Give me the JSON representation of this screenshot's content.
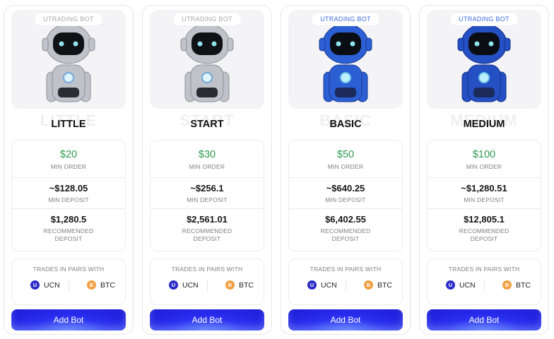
{
  "colors": {
    "accent": "#2a2ff0",
    "price": "#2d9a4e",
    "silver_robot": "#b9bcc2",
    "blue_robot": "#2554c8"
  },
  "plans": [
    {
      "tag": "UTRADING BOT",
      "robot": "silver",
      "ghost": "LITTLE",
      "name": "LITTLE",
      "price": "$20",
      "price_label": "MIN ORDER",
      "min_deposit": "~$128.05",
      "min_deposit_label": "MIN DEPOSIT",
      "recommended": "$1,280.5",
      "recommended_label_1": "RECOMMENDED",
      "recommended_label_2": "DEPOSIT",
      "pairs_label": "TRADES IN PAIRS WITH",
      "coin_a": "UCN",
      "coin_b": "BTC",
      "button": "Add Bot"
    },
    {
      "tag": "UTRADING BOT",
      "robot": "silver",
      "ghost": "START",
      "name": "START",
      "price": "$30",
      "price_label": "MIN ORDER",
      "min_deposit": "~$256.1",
      "min_deposit_label": "MIN DEPOSIT",
      "recommended": "$2,561.01",
      "recommended_label_1": "RECOMMENDED",
      "recommended_label_2": "DEPOSIT",
      "pairs_label": "TRADES IN PAIRS WITH",
      "coin_a": "UCN",
      "coin_b": "BTC",
      "button": "Add Bot"
    },
    {
      "tag": "UTRADING BOT",
      "robot": "blue",
      "ghost": "BASIC",
      "name": "BASIC",
      "price": "$50",
      "price_label": "MIN ORDER",
      "min_deposit": "~$640.25",
      "min_deposit_label": "MIN DEPOSIT",
      "recommended": "$6,402.55",
      "recommended_label_1": "RECOMMENDED",
      "recommended_label_2": "DEPOSIT",
      "pairs_label": "TRADES IN PAIRS WITH",
      "coin_a": "UCN",
      "coin_b": "BTC",
      "button": "Add Bot"
    },
    {
      "tag": "UTRADING BOT",
      "robot": "blue",
      "ghost": "MEDIUM",
      "name": "MEDIUM",
      "price": "$100",
      "price_label": "MIN ORDER",
      "min_deposit": "~$1,280.51",
      "min_deposit_label": "MIN DEPOSIT",
      "recommended": "$12,805.1",
      "recommended_label_1": "RECOMMENDED",
      "recommended_label_2": "DEPOSIT",
      "pairs_label": "TRADES IN PAIRS WITH",
      "coin_a": "UCN",
      "coin_b": "BTC",
      "button": "Add Bot"
    }
  ]
}
